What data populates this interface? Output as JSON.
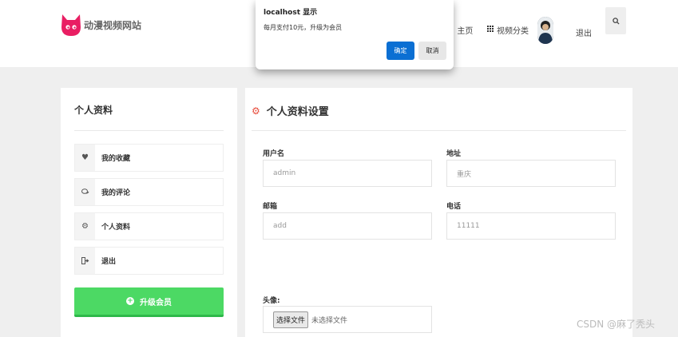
{
  "header": {
    "site_name": "动漫视频网站",
    "nav_home": "主页",
    "nav_categories": "视频分类",
    "logout": "退出"
  },
  "sidebar": {
    "title": "个人资料",
    "items": [
      {
        "label": "我的收藏",
        "icon": "heart-icon"
      },
      {
        "label": "我的评论",
        "icon": "comments-icon"
      },
      {
        "label": "个人资料",
        "icon": "gears-icon"
      },
      {
        "label": "退出",
        "icon": "sign-out-icon"
      }
    ],
    "upgrade_label": "升级会员"
  },
  "main": {
    "title": "个人资料设置",
    "username_label": "用户名",
    "username_value": "admin",
    "address_label": "地址",
    "address_value": "重庆",
    "email_label": "邮箱",
    "email_value": "add",
    "phone_label": "电话",
    "phone_value": "11111",
    "avatar_label": "头像:",
    "file_button": "选择文件",
    "file_status": "未选择文件"
  },
  "dialog": {
    "title": "localhost 显示",
    "message": "每月支付10元，升级为会员",
    "ok": "确定",
    "cancel": "取消"
  },
  "watermark": "CSDN @麻了秃头",
  "colors": {
    "logo": "#e91e63",
    "upgrade_button": "#4cd964",
    "dialog_ok": "#0b6fd3",
    "title_icon": "#e74c3c"
  }
}
